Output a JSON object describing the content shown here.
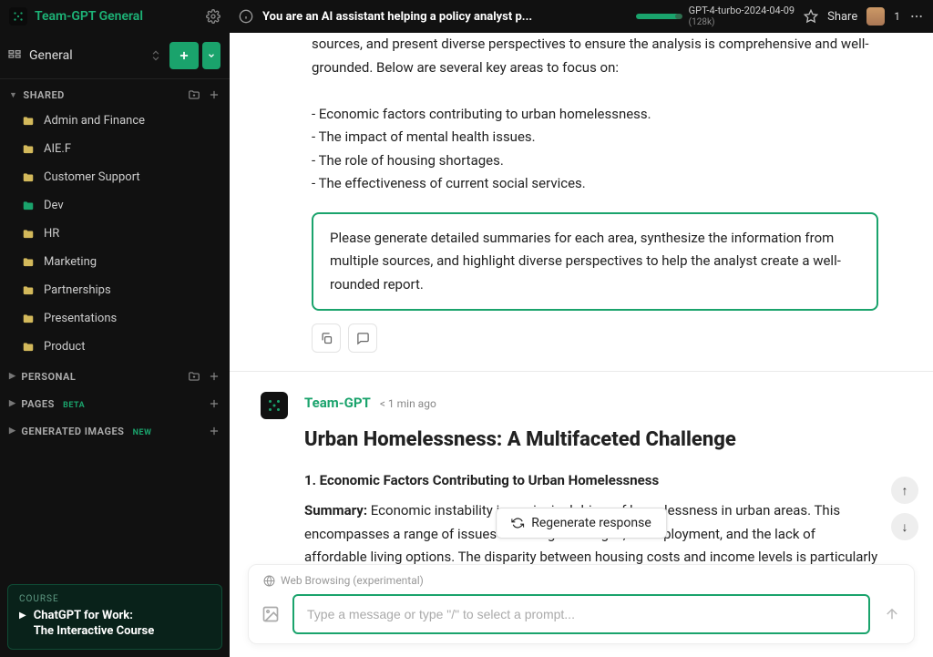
{
  "app": {
    "title": "Team-GPT General"
  },
  "sidebar": {
    "general_label": "General",
    "sections": {
      "shared": {
        "label": "SHARED",
        "items": [
          {
            "label": "Admin and Finance",
            "color": "yellow"
          },
          {
            "label": "AIE.F",
            "color": "yellow"
          },
          {
            "label": "Customer Support",
            "color": "yellow"
          },
          {
            "label": "Dev",
            "color": "green"
          },
          {
            "label": "HR",
            "color": "yellow"
          },
          {
            "label": "Marketing",
            "color": "yellow"
          },
          {
            "label": "Partnerships",
            "color": "yellow"
          },
          {
            "label": "Presentations",
            "color": "yellow"
          },
          {
            "label": "Product",
            "color": "yellow"
          }
        ]
      },
      "personal": {
        "label": "PERSONAL"
      },
      "pages": {
        "label": "PAGES",
        "badge": "BETA"
      },
      "generated_images": {
        "label": "GENERATED IMAGES",
        "badge": "NEW"
      }
    },
    "course": {
      "eyebrow": "COURSE",
      "title_line1": "ChatGPT for Work:",
      "title_line2": "The Interactive Course"
    }
  },
  "header": {
    "chat_title": "You are an AI assistant helping a policy analyst p...",
    "model_name": "GPT-4-turbo-2024-04-09",
    "model_context": "(128k)",
    "share_label": "Share",
    "avatar_count": "1"
  },
  "prompt": {
    "continuation": "sources, and present diverse perspectives to ensure the analysis is comprehensive and well-grounded. Below are several key areas to focus on:",
    "bullets": [
      "- Economic factors contributing to urban homelessness.",
      "- The impact of mental health issues.",
      "- The role of housing shortages.",
      "- The effectiveness of current social services."
    ],
    "highlight": "Please generate detailed summaries for each area, synthesize the information from multiple sources, and highlight diverse perspectives to help the analyst create a well-rounded report."
  },
  "response": {
    "author": "Team-GPT",
    "time": "< 1 min ago",
    "title": "Urban Homelessness: A Multifaceted Challenge",
    "section1_heading": "1. Economic Factors Contributing to Urban Homelessness",
    "summary_label": "Summary:",
    "section1_body": " Economic instability is a principal driver of homelessness in urban areas. This encompasses a range of issues including low wages, unemployment, and the lack of affordable living options. The disparity between housing costs and income levels is particularly pronounced in metropolitan areas where the cost of living tends to be"
  },
  "actions": {
    "regenerate_label": "Regenerate response"
  },
  "input": {
    "mode_label": "Web Browsing (experimental)",
    "placeholder": "Type a message or type \"/\" to select a prompt..."
  }
}
